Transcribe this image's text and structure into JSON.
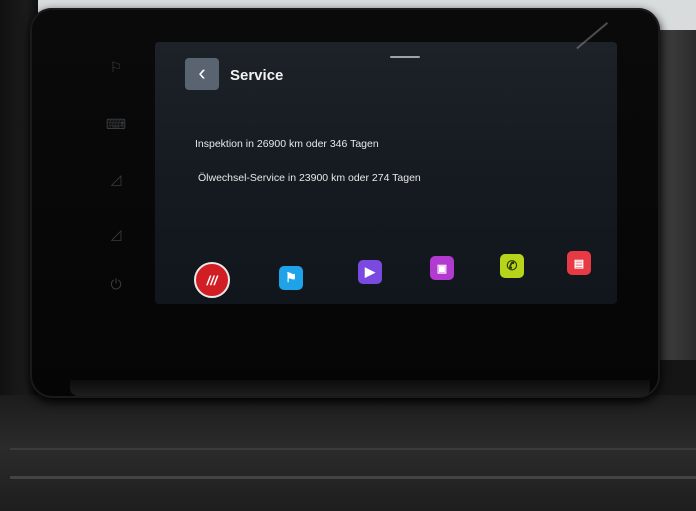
{
  "header": {
    "title": "Service",
    "back_icon": "chevron-left-icon"
  },
  "service": {
    "inspection": "Inspektion in 26900 km oder 346 Tagen",
    "oil_change": "Ölwechsel-Service in 23900 km oder 274 Tagen"
  },
  "dock": {
    "apps": [
      {
        "icon": "home-icon",
        "glyph": "///",
        "color": "#d11e24"
      },
      {
        "icon": "navigation-icon",
        "glyph": "⚑",
        "color": "#1ea3e8"
      },
      {
        "icon": "media-icon",
        "glyph": "▶",
        "color": "#7a4ae0"
      },
      {
        "icon": "radio-icon",
        "glyph": "▣",
        "color": "#b33ad0"
      },
      {
        "icon": "phone-icon",
        "glyph": "✆",
        "color": "#b8d41a"
      },
      {
        "icon": "car-settings-icon",
        "glyph": "▤",
        "color": "#e83a45"
      }
    ]
  },
  "side_buttons": [
    {
      "icon": "flag-icon",
      "glyph": "⚐"
    },
    {
      "icon": "keyboard-icon",
      "glyph": "⌨"
    },
    {
      "icon": "volume-up-icon",
      "glyph": "◿"
    },
    {
      "icon": "volume-down-icon",
      "glyph": "◿"
    },
    {
      "icon": "power-icon",
      "glyph": "⏻"
    }
  ]
}
